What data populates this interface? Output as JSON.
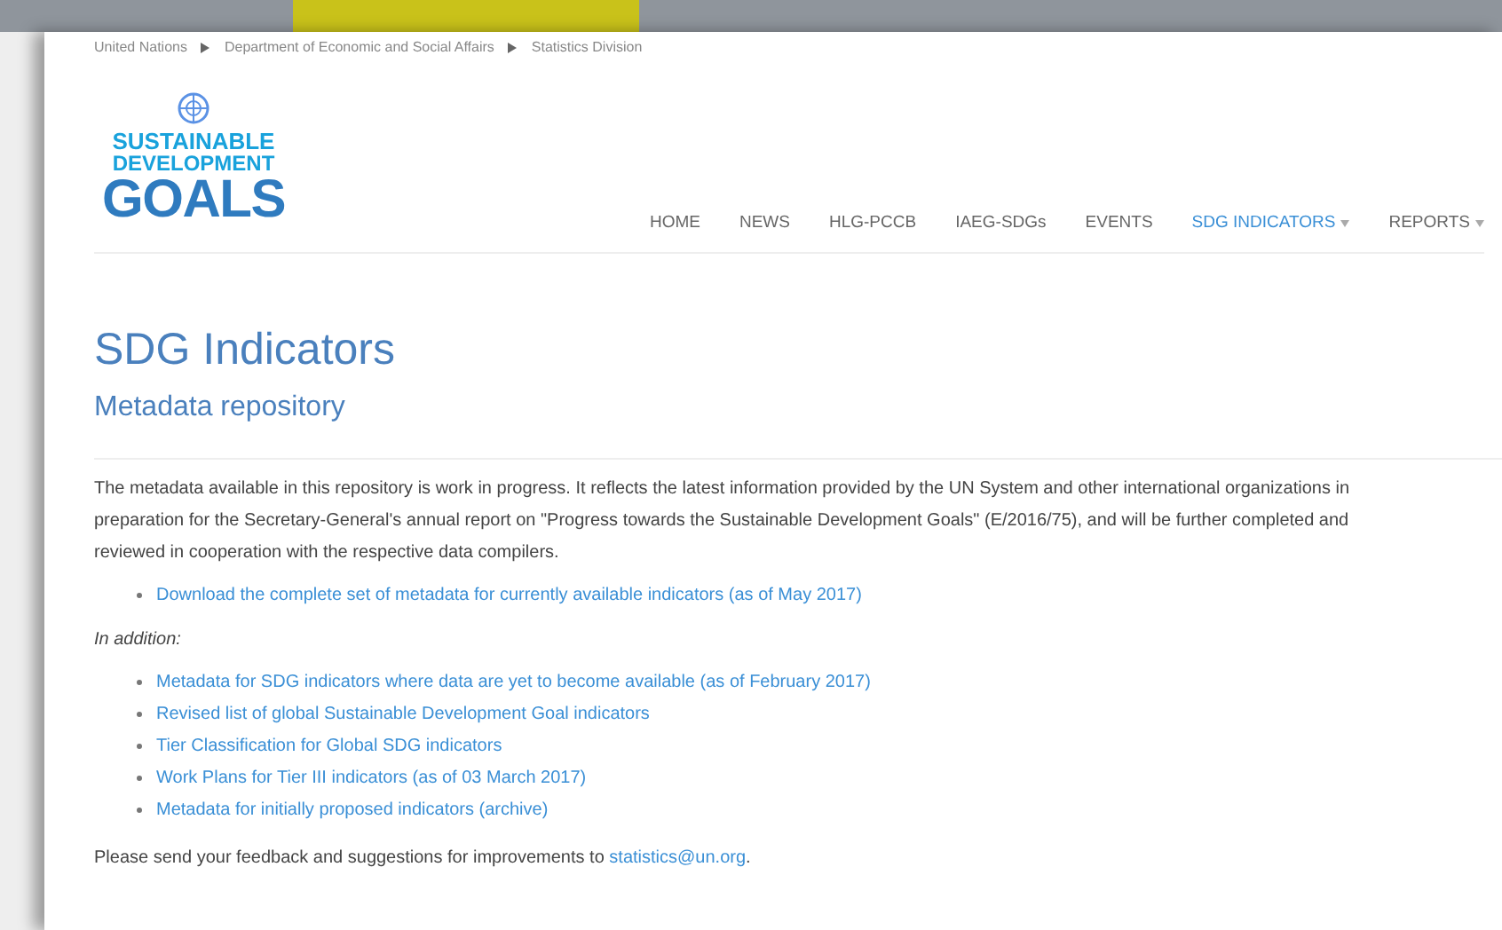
{
  "breadcrumb": [
    "United Nations",
    "Department of Economic and Social Affairs",
    "Statistics Division"
  ],
  "logo": {
    "lines": [
      "SUSTAINABLE",
      "DEVELOPMENT",
      "GOALS"
    ]
  },
  "nav": [
    {
      "label": "HOME",
      "selected": false,
      "dropdown": false
    },
    {
      "label": "NEWS",
      "selected": false,
      "dropdown": false
    },
    {
      "label": "HLG-PCCB",
      "selected": false,
      "dropdown": false
    },
    {
      "label": "IAEG-SDGs",
      "selected": false,
      "dropdown": false
    },
    {
      "label": "EVENTS",
      "selected": false,
      "dropdown": false
    },
    {
      "label": "SDG INDICATORS",
      "selected": true,
      "dropdown": true
    },
    {
      "label": "REPORTS",
      "selected": false,
      "dropdown": true
    }
  ],
  "title": "SDG Indicators",
  "subtitle": "Metadata repository",
  "intro": "The metadata available in this repository is work in progress. It reflects the latest information provided by the UN System and other international organizations in preparation for the Secretary-General's annual report on \"Progress towards the Sustainable Development Goals\" (E/2016/75), and will be further completed and reviewed in cooperation with the respective data compilers.",
  "main_links": [
    "Download the complete set of metadata for currently available indicators (as of May 2017)"
  ],
  "addition_label": "In addition:",
  "addition_links": [
    "Metadata for SDG indicators where data are yet to become available (as of February 2017)",
    "Revised list of global Sustainable Development Goal indicators",
    "Tier Classification for Global SDG indicators",
    "Work Plans for Tier III indicators (as of 03 March 2017)",
    "Metadata for initially proposed indicators (archive)"
  ],
  "feedback": {
    "text": "Please send your feedback and suggestions for improvements to",
    "link": "statistics@un.org",
    "after": "."
  }
}
